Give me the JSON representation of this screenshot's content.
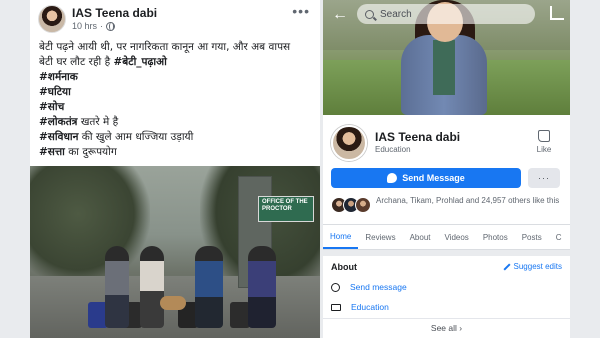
{
  "post": {
    "author": "IAS Teena dabi",
    "time": "10 hrs",
    "dot": "·",
    "more_icon": "more-dots-icon",
    "lines": [
      {
        "pre": "बेटी पढ़ने आयी थी, पर नागरिकता कानून आ गया, और अब वापस",
        "bold": "",
        "post": ""
      },
      {
        "pre": "बेटी घर लौट रही है ",
        "bold": "#बेटी_पढ़ाओ",
        "post": ""
      },
      {
        "pre": "",
        "bold": "#शर्मनाक",
        "post": ""
      },
      {
        "pre": "",
        "bold": "#घटिया",
        "post": ""
      },
      {
        "pre": "",
        "bold": "#सोच",
        "post": ""
      },
      {
        "pre": "",
        "bold": "#लोकतंत्र",
        "post": " खतरे मे है"
      },
      {
        "pre": "",
        "bold": "#सविधान",
        "post": " की खुले आम धज्जिया उड़ायी"
      },
      {
        "pre": "",
        "bold": "#सत्ता",
        "post": " का दुरूपयोग"
      }
    ],
    "photo_sign": "OFFICE OF THE PROCTOR"
  },
  "page": {
    "search_placeholder": "Search",
    "name": "IAS Teena dabi",
    "category": "Education",
    "like_label": "Like",
    "send_message": "Send Message",
    "more_label": "···",
    "friends_text": "Archana, Tikam, Prohlad and 24,957 others like this",
    "tabs": [
      "Home",
      "Reviews",
      "About",
      "Videos",
      "Photos",
      "Posts",
      "C"
    ],
    "about_title": "About",
    "suggest_edits": "Suggest edits",
    "about_items": [
      "Send message",
      "Education"
    ],
    "see_all": "See all  ›"
  },
  "colors": {
    "accent": "#1877f2",
    "text": "#1c1e21",
    "muted": "#606770"
  }
}
